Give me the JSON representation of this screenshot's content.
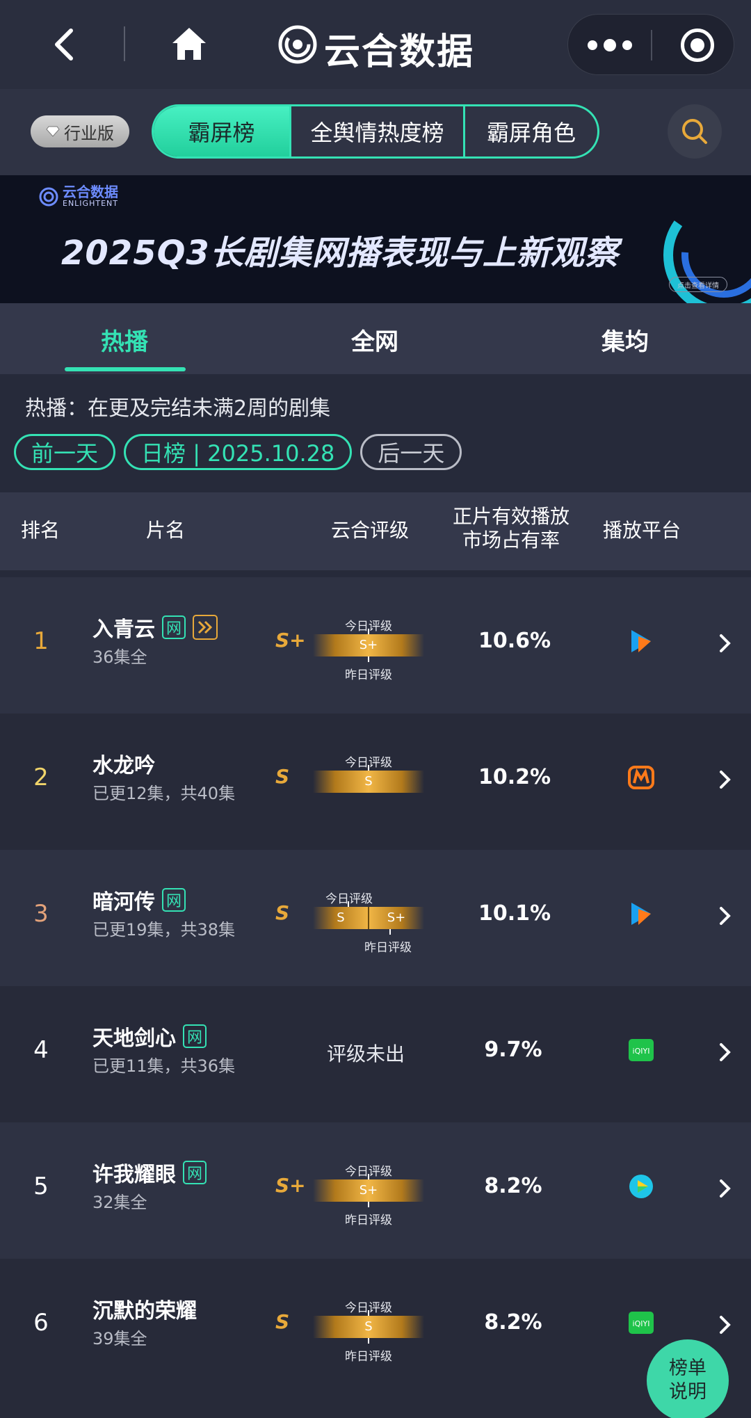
{
  "app": {
    "title": "云合数据"
  },
  "edition_badge": "行业版",
  "segments": [
    "霸屏榜",
    "全舆情热度榜",
    "霸屏角色"
  ],
  "banner": {
    "logo_text": "云合数据",
    "logo_sub": "ENLIGHTENT",
    "title": "2025Q3长剧集网播表现与上新观察",
    "link": "点击查看详情"
  },
  "tabs": [
    "热播",
    "全网",
    "集均"
  ],
  "description": "热播：在更及完结未满2周的剧集",
  "date_nav": {
    "prev": "前一天",
    "current": "日榜 | 2025.10.28",
    "next": "后一天"
  },
  "table_headers": {
    "rank": "排名",
    "title": "片名",
    "grade": "云合评级",
    "share": "正片有效播放\n市场占有率",
    "platform": "播放平台"
  },
  "rating_labels": {
    "today": "今日评级",
    "yesterday": "昨日评级",
    "none": "评级未出"
  },
  "platform_icons": [
    "tencent-video-icon",
    "mango-tv-icon",
    "iqiyi-icon",
    "youku-icon"
  ],
  "rows": [
    {
      "rank": "1",
      "title": "入青云",
      "wang": "网",
      "vip": true,
      "sub": "36集全",
      "grade": "S+",
      "today": "S+",
      "yesterday": "",
      "share": "10.6%",
      "platform": "tencent-video-icon"
    },
    {
      "rank": "2",
      "title": "水龙吟",
      "wang": "",
      "vip": false,
      "sub": "已更12集，共40集",
      "grade": "S",
      "today": "S",
      "yesterday": "",
      "share": "10.2%",
      "platform": "mango-tv-icon"
    },
    {
      "rank": "3",
      "title": "暗河传",
      "wang": "网",
      "vip": false,
      "sub": "已更19集，共38集",
      "grade": "S",
      "today": "S",
      "yesterday": "S+",
      "share": "10.1%",
      "platform": "tencent-video-icon"
    },
    {
      "rank": "4",
      "title": "天地剑心",
      "wang": "网",
      "vip": false,
      "sub": "已更11集，共36集",
      "grade": "",
      "today": "",
      "yesterday": "",
      "share": "9.7%",
      "platform": "iqiyi-icon"
    },
    {
      "rank": "5",
      "title": "许我耀眼",
      "wang": "网",
      "vip": false,
      "sub": "32集全",
      "grade": "S+",
      "today": "S+",
      "yesterday": "",
      "share": "8.2%",
      "platform": "youku-icon"
    },
    {
      "rank": "6",
      "title": "沉默的荣耀",
      "wang": "",
      "vip": false,
      "sub": "39集全",
      "grade": "S",
      "today": "S",
      "yesterday": "",
      "share": "8.2%",
      "platform": "iqiyi-icon"
    }
  ],
  "help_button": [
    "榜单",
    "说明"
  ],
  "colors": {
    "accent": "#34e2b4",
    "gold": "#e8a93a",
    "background": "#262a3a"
  }
}
